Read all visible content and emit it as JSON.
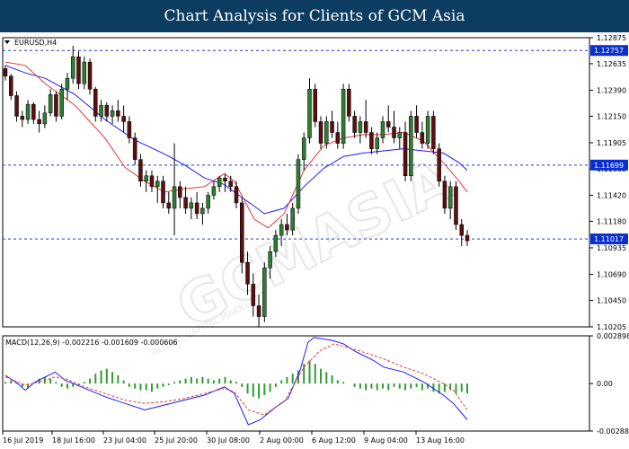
{
  "header": {
    "title": "Chart Analysis for Clients of GCM Asia"
  },
  "watermark": {
    "brand": "GCMASIA",
    "subtitle": "GLOBAL CAPITAL MARKETS"
  },
  "colors": {
    "bull": "#2e7d32",
    "bear": "#5a1010",
    "line_blue": "#1a1aff",
    "line_red": "#e53935",
    "level": "#1f3fd0",
    "hist": "#2e9e2e",
    "grid": "#c8c8c8",
    "banner": "#0d3c61"
  },
  "chart_data": [
    {
      "type": "candlestick",
      "title": "EURUSD,H4",
      "ylim": [
        1.10205,
        1.12875
      ],
      "y_ticks": [
        "1.12875",
        "1.12635",
        "1.12390",
        "1.12150",
        "1.11905",
        "1.11665",
        "1.11420",
        "1.11180",
        "1.10935",
        "1.10690",
        "1.10450",
        "1.10205"
      ],
      "x_ticks": [
        "16 Jul 2019",
        "18 Jul 16:00",
        "23 Jul 04:00",
        "25 Jul 20:00",
        "30 Jul 08:00",
        "2 Aug 00:00",
        "6 Aug 12:00",
        "9 Aug 04:00",
        "13 Aug 16:00"
      ],
      "levels": [
        {
          "label": "1.12757",
          "value": 1.12757
        },
        {
          "label": "1.11699",
          "value": 1.11699
        },
        {
          "label": "1.11017",
          "value": 1.11017
        }
      ],
      "moving_averages": [
        {
          "color": "blue",
          "points": [
            [
              0,
              1.1262
            ],
            [
              10,
              1.1255
            ],
            [
              20,
              1.125
            ],
            [
              35,
              1.1235
            ],
            [
              50,
              1.1212
            ],
            [
              65,
              1.1193
            ],
            [
              80,
              1.118
            ],
            [
              90,
              1.117
            ],
            [
              100,
              1.1158
            ],
            [
              110,
              1.1152
            ],
            [
              115,
              1.1145
            ],
            [
              125,
              1.1132
            ],
            [
              130,
              1.1125
            ],
            [
              140,
              1.113
            ],
            [
              150,
              1.115
            ],
            [
              160,
              1.1167
            ],
            [
              170,
              1.1178
            ],
            [
              180,
              1.1181
            ],
            [
              190,
              1.1183
            ],
            [
              200,
              1.1185
            ],
            [
              210,
              1.1183
            ],
            [
              220,
              1.1181
            ],
            [
              228,
              1.1172
            ],
            [
              232,
              1.1165
            ]
          ]
        },
        {
          "color": "red",
          "points": [
            [
              0,
              1.1265
            ],
            [
              10,
              1.1262
            ],
            [
              20,
              1.1245
            ],
            [
              35,
              1.1225
            ],
            [
              50,
              1.1195
            ],
            [
              60,
              1.1168
            ],
            [
              70,
              1.1155
            ],
            [
              80,
              1.1145
            ],
            [
              90,
              1.1148
            ],
            [
              100,
              1.115
            ],
            [
              110,
              1.1162
            ],
            [
              115,
              1.1155
            ],
            [
              125,
              1.112
            ],
            [
              132,
              1.1112
            ],
            [
              140,
              1.1125
            ],
            [
              150,
              1.1165
            ],
            [
              160,
              1.1188
            ],
            [
              170,
              1.1195
            ],
            [
              180,
              1.1198
            ],
            [
              190,
              1.1198
            ],
            [
              200,
              1.12
            ],
            [
              210,
              1.1192
            ],
            [
              220,
              1.1172
            ],
            [
              228,
              1.1155
            ],
            [
              232,
              1.1145
            ]
          ]
        }
      ],
      "candles": [
        [
          1.1259,
          1.1262,
          1.1248,
          1.1252
        ],
        [
          1.1252,
          1.1254,
          1.123,
          1.1234
        ],
        [
          1.1234,
          1.1238,
          1.121,
          1.1215
        ],
        [
          1.1215,
          1.122,
          1.1205,
          1.1212
        ],
        [
          1.1212,
          1.123,
          1.1208,
          1.1226
        ],
        [
          1.1226,
          1.1228,
          1.1208,
          1.1212
        ],
        [
          1.1212,
          1.122,
          1.12,
          1.1208
        ],
        [
          1.1208,
          1.1225,
          1.1204,
          1.1218
        ],
        [
          1.1218,
          1.124,
          1.1215,
          1.1235
        ],
        [
          1.1235,
          1.1238,
          1.121,
          1.1215
        ],
        [
          1.1215,
          1.1245,
          1.1212,
          1.124
        ],
        [
          1.124,
          1.1255,
          1.123,
          1.125
        ],
        [
          1.125,
          1.128,
          1.1245,
          1.127
        ],
        [
          1.127,
          1.1275,
          1.124,
          1.1245
        ],
        [
          1.1245,
          1.127,
          1.124,
          1.1265
        ],
        [
          1.1265,
          1.1268,
          1.1235,
          1.124
        ],
        [
          1.124,
          1.1242,
          1.121,
          1.1215
        ],
        [
          1.1215,
          1.123,
          1.121,
          1.1225
        ],
        [
          1.1225,
          1.1228,
          1.121,
          1.1215
        ],
        [
          1.1215,
          1.1225,
          1.1208,
          1.122
        ],
        [
          1.122,
          1.123,
          1.121,
          1.1215
        ],
        [
          1.1215,
          1.1225,
          1.12,
          1.121
        ],
        [
          1.121,
          1.1215,
          1.119,
          1.1195
        ],
        [
          1.1195,
          1.12,
          1.117,
          1.1175
        ],
        [
          1.1175,
          1.118,
          1.115,
          1.1155
        ],
        [
          1.1155,
          1.1165,
          1.1145,
          1.116
        ],
        [
          1.116,
          1.1165,
          1.1145,
          1.115
        ],
        [
          1.115,
          1.116,
          1.1135,
          1.1155
        ],
        [
          1.1155,
          1.116,
          1.113,
          1.1135
        ],
        [
          1.1135,
          1.1145,
          1.1125,
          1.113
        ],
        [
          1.113,
          1.119,
          1.1105,
          1.115
        ],
        [
          1.115,
          1.1155,
          1.113,
          1.114
        ],
        [
          1.114,
          1.115,
          1.1125,
          1.113
        ],
        [
          1.113,
          1.114,
          1.112,
          1.1135
        ],
        [
          1.1135,
          1.1145,
          1.112,
          1.1125
        ],
        [
          1.1125,
          1.1135,
          1.1115,
          1.113
        ],
        [
          1.113,
          1.1145,
          1.1125,
          1.1142
        ],
        [
          1.1142,
          1.1155,
          1.1138,
          1.115
        ],
        [
          1.115,
          1.116,
          1.1145,
          1.1158
        ],
        [
          1.1158,
          1.1162,
          1.1145,
          1.1155
        ],
        [
          1.1155,
          1.116,
          1.1145,
          1.115
        ],
        [
          1.115,
          1.1155,
          1.113,
          1.1135
        ],
        [
          1.1135,
          1.114,
          1.107,
          1.108
        ],
        [
          1.108,
          1.109,
          1.105,
          1.106
        ],
        [
          1.106,
          1.107,
          1.103,
          1.104
        ],
        [
          1.104,
          1.105,
          1.102,
          1.103
        ],
        [
          1.103,
          1.108,
          1.1025,
          1.1075
        ],
        [
          1.1075,
          1.1095,
          1.1065,
          1.109
        ],
        [
          1.109,
          1.111,
          1.1085,
          1.1105
        ],
        [
          1.1105,
          1.112,
          1.1095,
          1.1115
        ],
        [
          1.1115,
          1.1125,
          1.1105,
          1.111
        ],
        [
          1.111,
          1.1135,
          1.1105,
          1.113
        ],
        [
          1.113,
          1.118,
          1.1125,
          1.1175
        ],
        [
          1.1175,
          1.12,
          1.1165,
          1.1195
        ],
        [
          1.1195,
          1.125,
          1.119,
          1.124
        ],
        [
          1.124,
          1.1245,
          1.1205,
          1.121
        ],
        [
          1.121,
          1.1215,
          1.1185,
          1.119
        ],
        [
          1.119,
          1.1215,
          1.1185,
          1.121
        ],
        [
          1.121,
          1.122,
          1.1195,
          1.12
        ],
        [
          1.12,
          1.121,
          1.1185,
          1.119
        ],
        [
          1.119,
          1.1245,
          1.1185,
          1.124
        ],
        [
          1.124,
          1.1245,
          1.121,
          1.1215
        ],
        [
          1.1215,
          1.122,
          1.1195,
          1.12
        ],
        [
          1.12,
          1.1215,
          1.119,
          1.121
        ],
        [
          1.121,
          1.123,
          1.1195,
          1.12
        ],
        [
          1.12,
          1.1205,
          1.118,
          1.1185
        ],
        [
          1.1185,
          1.12,
          1.118,
          1.1195
        ],
        [
          1.1195,
          1.1215,
          1.119,
          1.121
        ],
        [
          1.121,
          1.1225,
          1.12,
          1.1205
        ],
        [
          1.1205,
          1.122,
          1.119,
          1.1195
        ],
        [
          1.1195,
          1.1205,
          1.1185,
          1.12
        ],
        [
          1.12,
          1.121,
          1.1155,
          1.116
        ],
        [
          1.116,
          1.122,
          1.1155,
          1.1215
        ],
        [
          1.1215,
          1.1225,
          1.1195,
          1.12
        ],
        [
          1.12,
          1.121,
          1.1185,
          1.119
        ],
        [
          1.119,
          1.122,
          1.1185,
          1.1215
        ],
        [
          1.1215,
          1.122,
          1.118,
          1.1185
        ],
        [
          1.1185,
          1.119,
          1.115,
          1.1155
        ],
        [
          1.1155,
          1.116,
          1.1125,
          1.113
        ],
        [
          1.113,
          1.1155,
          1.112,
          1.115
        ],
        [
          1.115,
          1.1155,
          1.111,
          1.1115
        ],
        [
          1.1115,
          1.112,
          1.1095,
          1.1105
        ],
        [
          1.1105,
          1.111,
          1.1095,
          1.11
        ]
      ]
    },
    {
      "type": "line",
      "title": "MACD(12,26,9) -0.002216 -0.001609 -0.000606",
      "ylim": [
        -0.002882,
        0.002898
      ],
      "y_ticks": [
        "0.002898",
        "0.00",
        "-0.002882"
      ],
      "series": [
        {
          "color": "blue",
          "points": [
            [
              0,
              0.0005
            ],
            [
              5,
              0.0001
            ],
            [
              10,
              -0.0004
            ],
            [
              15,
              0.0001
            ],
            [
              20,
              0.0004
            ],
            [
              25,
              0.0007
            ],
            [
              30,
              0.0002
            ],
            [
              40,
              -0.0003
            ],
            [
              50,
              -0.0008
            ],
            [
              60,
              -0.0012
            ],
            [
              70,
              -0.0016
            ],
            [
              80,
              -0.0013
            ],
            [
              90,
              -0.001
            ],
            [
              100,
              -0.0007
            ],
            [
              110,
              -0.0002
            ],
            [
              115,
              -0.0006
            ],
            [
              122,
              -0.0025
            ],
            [
              128,
              -0.0022
            ],
            [
              135,
              -0.0015
            ],
            [
              142,
              -0.0009
            ],
            [
              148,
              0.0008
            ],
            [
              152,
              0.0025
            ],
            [
              155,
              0.0028
            ],
            [
              160,
              0.0027
            ],
            [
              165,
              0.0026
            ],
            [
              170,
              0.0024
            ],
            [
              175,
              0.002
            ],
            [
              180,
              0.0017
            ],
            [
              185,
              0.0014
            ],
            [
              190,
              0.001
            ],
            [
              200,
              0.0007
            ],
            [
              205,
              0.0004
            ],
            [
              210,
              0.0001
            ],
            [
              215,
              -0.0003
            ],
            [
              220,
              -0.0007
            ],
            [
              225,
              -0.0012
            ],
            [
              232,
              -0.0022
            ]
          ]
        },
        {
          "color": "red",
          "points": [
            [
              0,
              0.0004
            ],
            [
              10,
              -0.0001
            ],
            [
              20,
              0.0002
            ],
            [
              25,
              0.0004
            ],
            [
              30,
              0.0003
            ],
            [
              40,
              -0.0002
            ],
            [
              50,
              -0.0006
            ],
            [
              60,
              -0.001
            ],
            [
              70,
              -0.0012
            ],
            [
              80,
              -0.0011
            ],
            [
              90,
              -0.0009
            ],
            [
              100,
              -0.0006
            ],
            [
              110,
              -0.0003
            ],
            [
              115,
              -0.0005
            ],
            [
              122,
              -0.0016
            ],
            [
              130,
              -0.0019
            ],
            [
              140,
              -0.0011
            ],
            [
              150,
              0.001
            ],
            [
              158,
              0.002
            ],
            [
              165,
              0.0024
            ],
            [
              172,
              0.0022
            ],
            [
              180,
              0.0019
            ],
            [
              190,
              0.0015
            ],
            [
              200,
              0.001
            ],
            [
              210,
              0.0006
            ],
            [
              220,
              0.0
            ],
            [
              225,
              -0.0004
            ],
            [
              232,
              -0.0016
            ]
          ]
        }
      ],
      "histogram": [
        0.0001,
        0.0002,
        0.0001,
        -0.0002,
        -0.0003,
        0.0,
        0.0003,
        0.0004,
        0.0003,
        0.0001,
        -0.0002,
        -0.0003,
        -0.0002,
        -0.0001,
        0.0001,
        0.0003,
        0.0006,
        0.0008,
        0.0009,
        0.0007,
        0.0005,
        0.0002,
        -0.0002,
        -0.0003,
        -0.0004,
        -0.0004,
        -0.0005,
        -0.0003,
        -0.0002,
        -0.0001,
        0.0001,
        0.0002,
        0.0003,
        0.0004,
        0.0003,
        0.0004,
        0.0003,
        0.0002,
        0.0003,
        0.0004,
        0.0002,
        0.0001,
        -0.0002,
        -0.0006,
        -0.0008,
        -0.0009,
        -0.0007,
        -0.0005,
        -0.0002,
        0.0002,
        0.0004,
        0.0006,
        0.0008,
        0.0012,
        0.0014,
        0.0012,
        0.0009,
        0.0007,
        0.0005,
        0.0002,
        0.0001,
        0.0,
        -0.0002,
        -0.0003,
        -0.0004,
        -0.0003,
        -0.0004,
        -0.0003,
        -0.0004,
        -0.0002,
        -0.0003,
        -0.0004,
        -0.0003,
        -0.0002,
        -0.0004,
        -0.0003,
        -0.0005,
        -0.0006,
        -0.0005,
        -0.0004,
        -0.0006,
        -0.0005,
        -0.0006
      ]
    }
  ]
}
